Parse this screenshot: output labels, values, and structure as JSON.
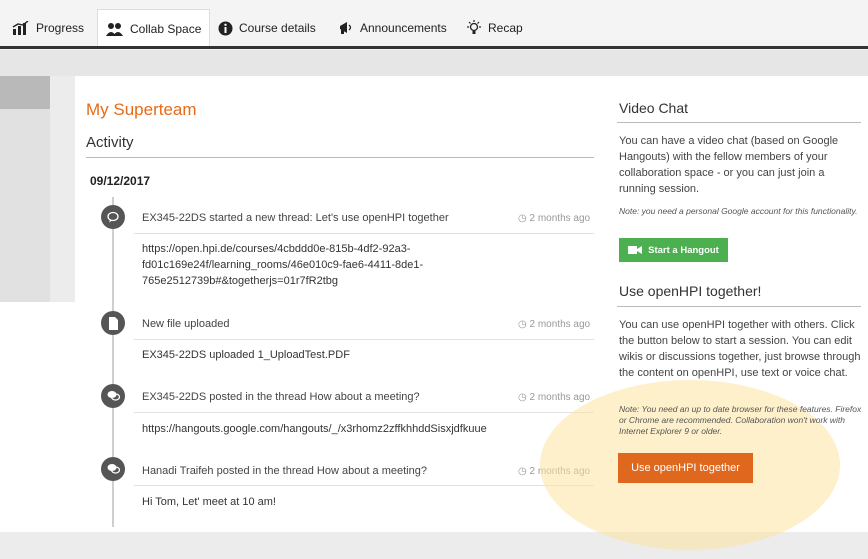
{
  "tabs": [
    {
      "label": "Progress",
      "icon": "bar-chart-icon"
    },
    {
      "label": "Collab Space",
      "icon": "users-icon"
    },
    {
      "label": "Course details",
      "icon": "info-icon"
    },
    {
      "label": "Announcements",
      "icon": "megaphone-icon"
    },
    {
      "label": "Recap",
      "icon": "lightbulb-icon"
    }
  ],
  "active_tab": "Collab Space",
  "group": {
    "title": "My Superteam",
    "activity_heading": "Activity",
    "date": "09/12/2017"
  },
  "activities": [
    {
      "icon": "comment-icon",
      "headline": "EX345-22DS started a new thread: Let's use openHPI together",
      "time": "2 months ago",
      "body": [
        "https://open.hpi.de/courses/4cbddd0e-815b-4df2-92a3-",
        "fd01c169e24f/learning_rooms/46e010c9-fae6-4411-8de1-",
        "765e2512739b#&togetherjs=01r7fR2tbg"
      ]
    },
    {
      "icon": "file-icon",
      "headline": "New file uploaded",
      "time": "2 months ago",
      "body": [
        "EX345-22DS uploaded 1_UploadTest.PDF"
      ]
    },
    {
      "icon": "comments-icon",
      "headline": "EX345-22DS posted in the thread How about a meeting?",
      "time": "2 months ago",
      "body": [
        "https://hangouts.google.com/hangouts/_/x3rhomz2zffkhhddSisxjdfkuue"
      ]
    },
    {
      "icon": "comments-icon",
      "headline": "Hanadi Traifeh posted in the thread How about a meeting?",
      "time": "2 months ago",
      "body": [
        "Hi Tom, Let' meet at 10 am!"
      ]
    }
  ],
  "video_chat": {
    "title": "Video Chat",
    "text": "You can have a video chat (based on Google Hangouts) with the fellow members of your collaboration space - or you can just join a running session.",
    "note": "Note: you need a personal Google account for this functionality.",
    "button_label": "Start a Hangout"
  },
  "use_together": {
    "title": "Use openHPI together!",
    "text": "You can use openHPI together with others. Click the button below to start a session. You can edit wikis or discussions together, just browse through the content on openHPI, use text or voice chat.",
    "note": "Note: You need an up to date browser for these features. Firefox or Chrome are recommended. Collaboration won't work with Internet Explorer 9 or older.",
    "button_label": "Use openHPI together"
  },
  "colors": {
    "accent": "#e86a17",
    "hangout_green": "#4caf50",
    "button_orange": "#e0681e"
  }
}
